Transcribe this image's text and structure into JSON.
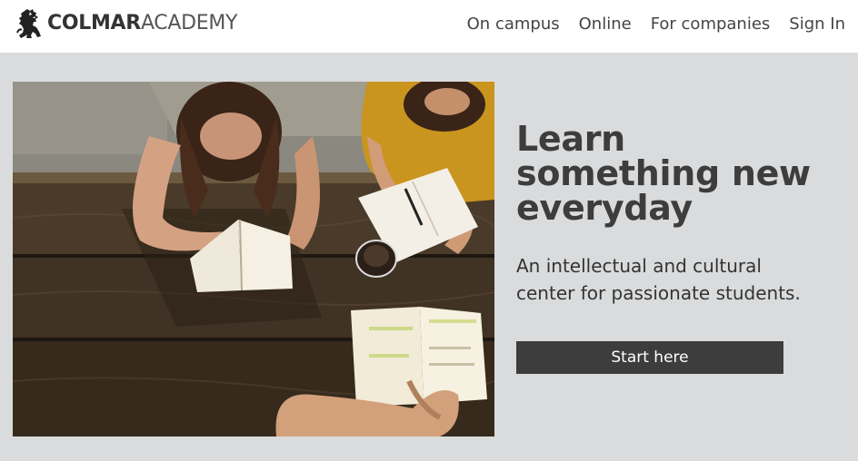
{
  "brand": {
    "name_bold": "COLMAR",
    "name_light": "ACADEMY",
    "logo_icon": "lion-rampant-icon"
  },
  "nav": {
    "items": [
      {
        "label": "On campus"
      },
      {
        "label": "Online"
      },
      {
        "label": "For companies"
      },
      {
        "label": "Sign In"
      }
    ]
  },
  "hero": {
    "title_line1": "Learn",
    "title_line2": "something new",
    "title_line3": "everyday",
    "subtitle_line1": "An intellectual and cultural",
    "subtitle_line2": "center for passionate students.",
    "cta_label": "Start here",
    "image": "students-reading-at-picnic-table"
  },
  "colors": {
    "hero_background": "#dadbdc",
    "button_background": "#3d3d3d",
    "button_text": "#ffffff"
  }
}
